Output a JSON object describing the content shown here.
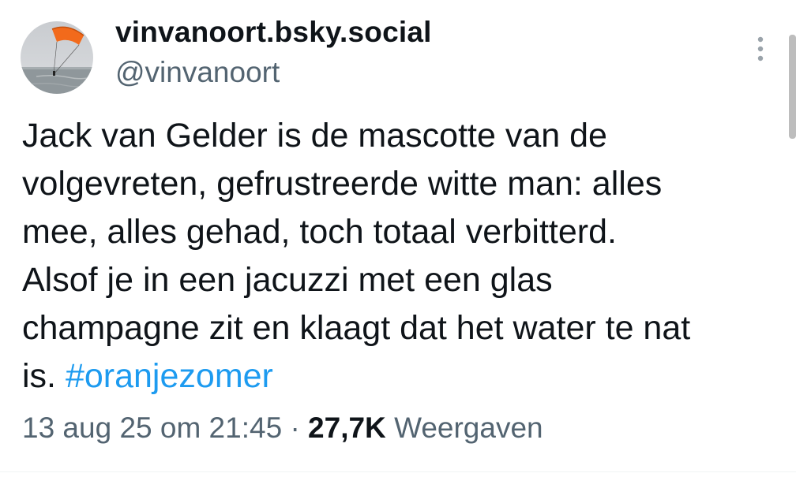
{
  "author": {
    "display_name": "vinvanoort.bsky.social",
    "handle": "@vinvanoort",
    "avatar_icon": "kitesurf-avatar-icon"
  },
  "menu": {
    "icon": "more-vertical-icon"
  },
  "tweet": {
    "lines": [
      "Jack van Gelder is de mascotte van de",
      "volgevreten, gefrustreerde witte man: alles",
      "mee, alles gehad, toch totaal verbitterd.",
      "Alsof je in een jacuzzi met een glas",
      "champagne zit en klaagt dat het water te nat"
    ],
    "last_line_text": "is.",
    "hashtag": "#oranjezomer"
  },
  "meta": {
    "timestamp": "13 aug 25 om 21:45",
    "separator": "·",
    "views_count": "27,7K",
    "views_label": "Weergaven"
  },
  "colors": {
    "text": "#0f1419",
    "secondary": "#536471",
    "link": "#1d9bf0"
  }
}
